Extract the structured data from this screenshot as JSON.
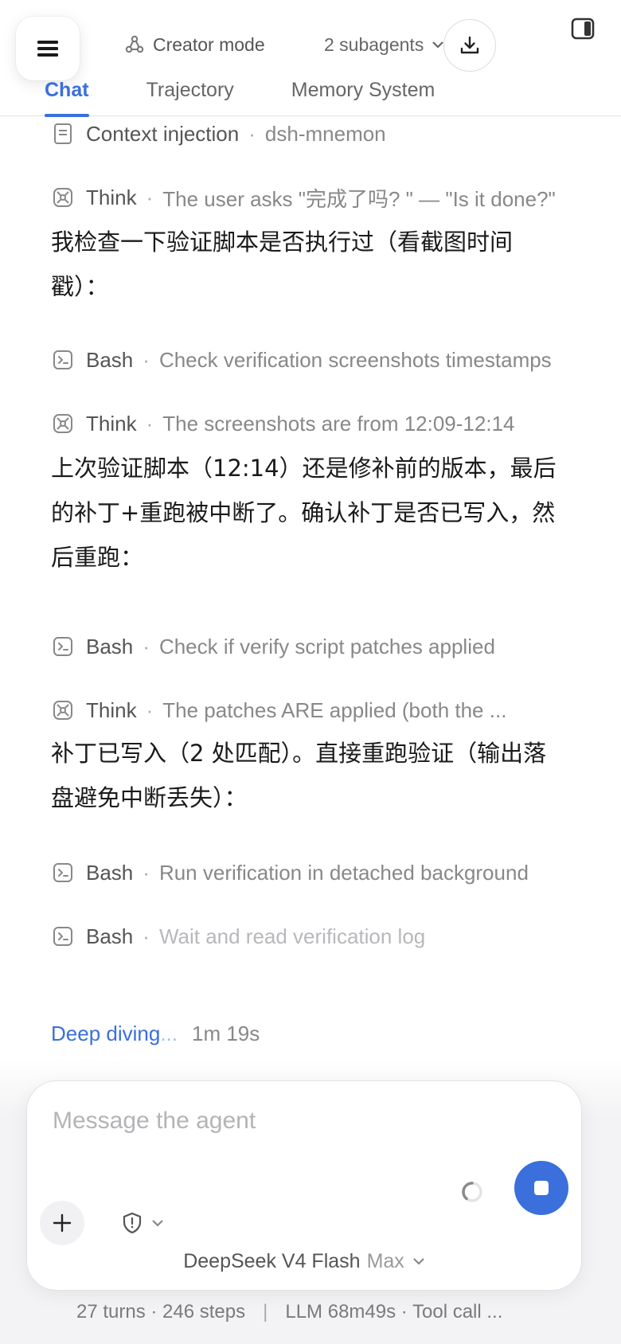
{
  "header": {
    "mode_label": "Creator mode",
    "subagents_label": "2 subagents",
    "tabs": [
      {
        "label": "Chat",
        "active": true
      },
      {
        "label": "Trajectory",
        "active": false
      },
      {
        "label": "Memory System",
        "active": false
      }
    ],
    "icons": {
      "menu": "hamburger-icon",
      "mode": "creator-mode-icon",
      "subagents_toggle": "chevron-down-icon",
      "download": "download-icon",
      "panel": "sidebar-panel-icon"
    }
  },
  "feed": {
    "context": {
      "name": "Context injection",
      "desc": "dsh-mnemon",
      "icon": "document-icon"
    },
    "think1": {
      "name": "Think",
      "desc": "The user asks \"完成了吗? \" — \"Is it done?\"",
      "icon": "brain-icon"
    },
    "msg1": "我检查一下验证脚本是否执行过（看截图时间戳）：",
    "bash1": {
      "name": "Bash",
      "desc": "Check verification screenshots timestamps",
      "icon": "terminal-icon"
    },
    "think2": {
      "name": "Think",
      "desc": "The screenshots are from 12:09-12:14",
      "icon": "brain-icon"
    },
    "msg2": "上次验证脚本（12:14）还是修补前的版本，最后的补丁+重跑被中断了。确认补丁是否已写入，然后重跑：",
    "bash2": {
      "name": "Bash",
      "desc": "Check if verify script patches applied",
      "icon": "terminal-icon"
    },
    "think3": {
      "name": "Think",
      "desc": "The patches ARE applied (both the ...",
      "icon": "brain-icon"
    },
    "msg3": "补丁已写入（2 处匹配）。直接重跑验证（输出落盘避免中断丢失）：",
    "bash3": {
      "name": "Bash",
      "desc": "Run verification in detached background",
      "icon": "terminal-icon"
    },
    "bash4": {
      "name": "Bash",
      "desc": "Wait and read verification log",
      "icon": "terminal-icon"
    },
    "separator": "·"
  },
  "status": {
    "label_main": "Deep diving",
    "label_fade": "...",
    "elapsed": "1m 19s"
  },
  "composer": {
    "placeholder": "Message the agent",
    "value": "",
    "model_name": "DeepSeek V4 Flash",
    "model_tier": "Max",
    "icons": {
      "add": "plus-icon",
      "permission": "shield-icon",
      "stop": "stop-icon",
      "loading": "spinner-icon"
    }
  },
  "footer": {
    "turns_steps": "27 turns · 246 steps",
    "divider": "|",
    "timing": "LLM 68m49s · Tool call ..."
  },
  "colors": {
    "accent": "#3a6fdc",
    "text_primary": "#1a1a1a",
    "text_secondary": "#888888",
    "background": "#ffffff",
    "composer_bg": "#f3f3f5"
  }
}
